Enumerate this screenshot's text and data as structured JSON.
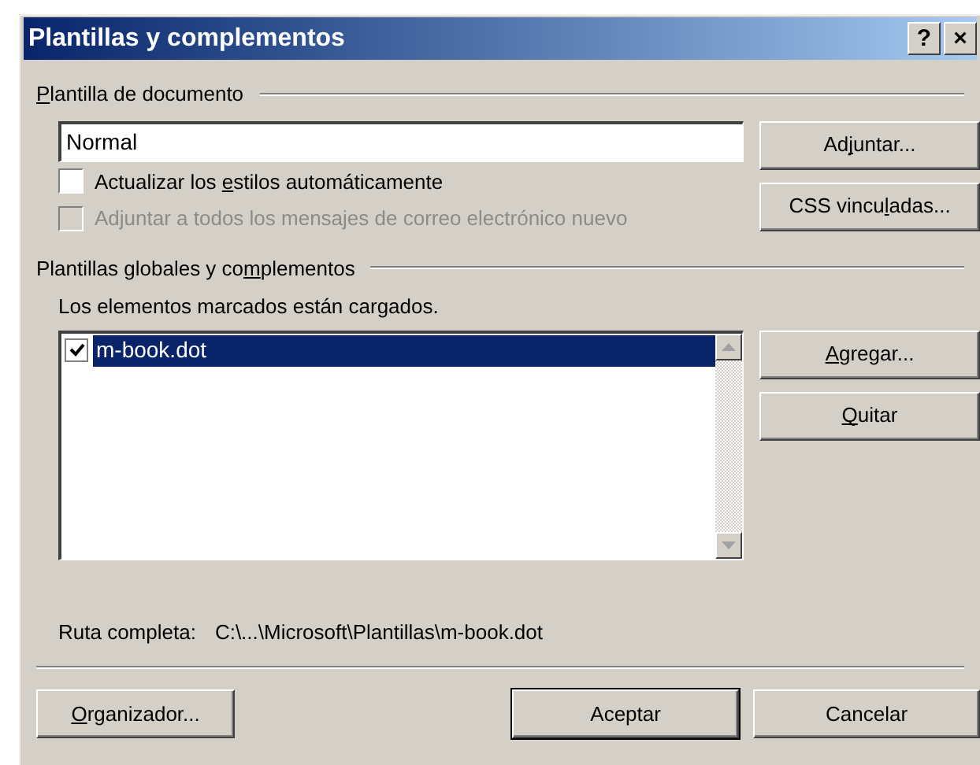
{
  "window": {
    "title": "Plantillas y complementos",
    "title_buttons": [
      "?",
      "×"
    ]
  },
  "document_template": {
    "heading_parts": [
      {
        "text": "P",
        "underlined": true
      },
      {
        "text": "lantilla de documento",
        "underlined": false
      }
    ],
    "value": "Normal",
    "options": [
      {
        "label_parts": [
          {
            "text": "Actualizar los ",
            "underlined": false
          },
          {
            "text": "e",
            "underlined": true
          },
          {
            "text": "stilos automáticamente",
            "underlined": false
          }
        ],
        "checked": false,
        "disabled": false
      },
      {
        "label_parts": [
          {
            "text": "Adjuntar a todos los mensajes de correo electrónico nuevo",
            "underlined": false
          }
        ],
        "checked": false,
        "disabled": true
      }
    ],
    "buttons": [
      {
        "label_parts": [
          {
            "text": "Ad",
            "underlined": false
          },
          {
            "text": "j",
            "underlined": true
          },
          {
            "text": "untar...",
            "underlined": false
          }
        ]
      },
      {
        "label_parts": [
          {
            "text": "CSS vincu",
            "underlined": false
          },
          {
            "text": "l",
            "underlined": true
          },
          {
            "text": "adas...",
            "underlined": false
          }
        ]
      }
    ]
  },
  "global_templates": {
    "heading_parts": [
      {
        "text": "Plantillas globales y co",
        "underlined": false
      },
      {
        "text": "m",
        "underlined": true
      },
      {
        "text": "plementos",
        "underlined": false
      }
    ],
    "note": "Los elementos marcados están cargados.",
    "items": [
      {
        "label": "m-book.dot",
        "checked": true,
        "selected": true
      }
    ],
    "buttons": [
      {
        "label_parts": [
          {
            "text": "A",
            "underlined": true
          },
          {
            "text": "gregar...",
            "underlined": false
          }
        ]
      },
      {
        "label_parts": [
          {
            "text": "Q",
            "underlined": true
          },
          {
            "text": "uitar",
            "underlined": false
          }
        ]
      }
    ]
  },
  "full_path": {
    "label": "Ruta completa:",
    "value": "C:\\...\\Microsoft\\Plantillas\\m-book.dot"
  },
  "footer_buttons": [
    {
      "label_parts": [
        {
          "text": "O",
          "underlined": true
        },
        {
          "text": "rganizador...",
          "underlined": false
        }
      ],
      "default": false
    },
    {
      "label_parts": [
        {
          "text": "Aceptar",
          "underlined": false
        }
      ],
      "default": true
    },
    {
      "label_parts": [
        {
          "text": "Cancelar",
          "underlined": false
        }
      ],
      "default": false
    }
  ]
}
